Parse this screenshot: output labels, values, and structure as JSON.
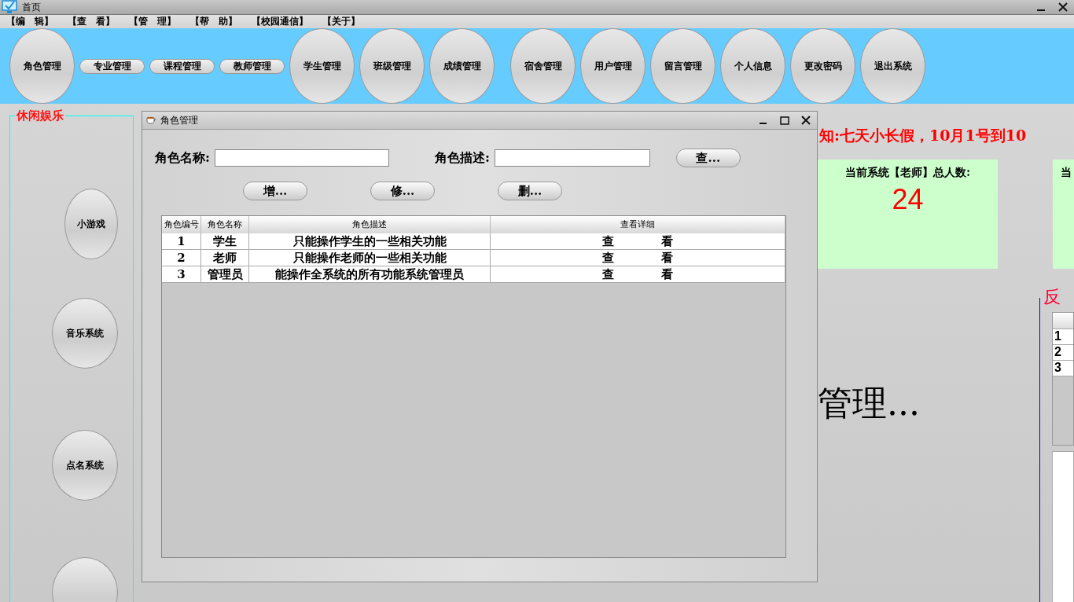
{
  "window": {
    "title": "首页"
  },
  "menu": [
    "【编　辑】",
    "【查　看】",
    "【管　理】",
    "【帮　助】",
    "【校园通信】",
    "【关于】"
  ],
  "toolbar": [
    {
      "label": "角色管理",
      "kind": "oval"
    },
    {
      "label": "专业管理",
      "kind": "pill"
    },
    {
      "label": "课程管理",
      "kind": "pill"
    },
    {
      "label": "教师管理",
      "kind": "pill"
    },
    {
      "label": "学生管理",
      "kind": "oval"
    },
    {
      "label": "班级管理",
      "kind": "oval"
    },
    {
      "label": "成绩管理",
      "kind": "oval"
    },
    {
      "label": "宿舍管理",
      "kind": "oval"
    },
    {
      "label": "用户管理",
      "kind": "oval"
    },
    {
      "label": "留言管理",
      "kind": "oval"
    },
    {
      "label": "个人信息",
      "kind": "oval"
    },
    {
      "label": "更改密码",
      "kind": "oval"
    },
    {
      "label": "退出系统",
      "kind": "oval"
    }
  ],
  "leisure": {
    "title": "休闲娱乐",
    "items": [
      "小游戏",
      "音乐系统",
      "点名系统"
    ]
  },
  "notice": "知:七天小长假，10月1号到10",
  "stats": [
    {
      "label": "当前系统【老师】总人数:",
      "value": "24"
    },
    {
      "label": "当"
    }
  ],
  "banner": "管理...",
  "feedback": {
    "title": "反",
    "rows": [
      "1",
      "2",
      "3"
    ]
  },
  "dialog": {
    "title": "角色管理",
    "fields": [
      {
        "label": "角色名称:"
      },
      {
        "label": "角色描述:"
      }
    ],
    "search_button": "查...",
    "buttons": [
      "增...",
      "修...",
      "删..."
    ],
    "table": {
      "columns": [
        "角色编号",
        "角色名称",
        "角色描述",
        "查看详细"
      ],
      "rows": [
        [
          "1",
          "学生",
          "只能操作学生的一些相关功能",
          "查　　　　看"
        ],
        [
          "2",
          "老师",
          "只能操作老师的一些相关功能",
          "查　　　　看"
        ],
        [
          "3",
          "管理员",
          "能操作全系统的所有功能系统管理员",
          "查　　　　看"
        ]
      ]
    }
  }
}
